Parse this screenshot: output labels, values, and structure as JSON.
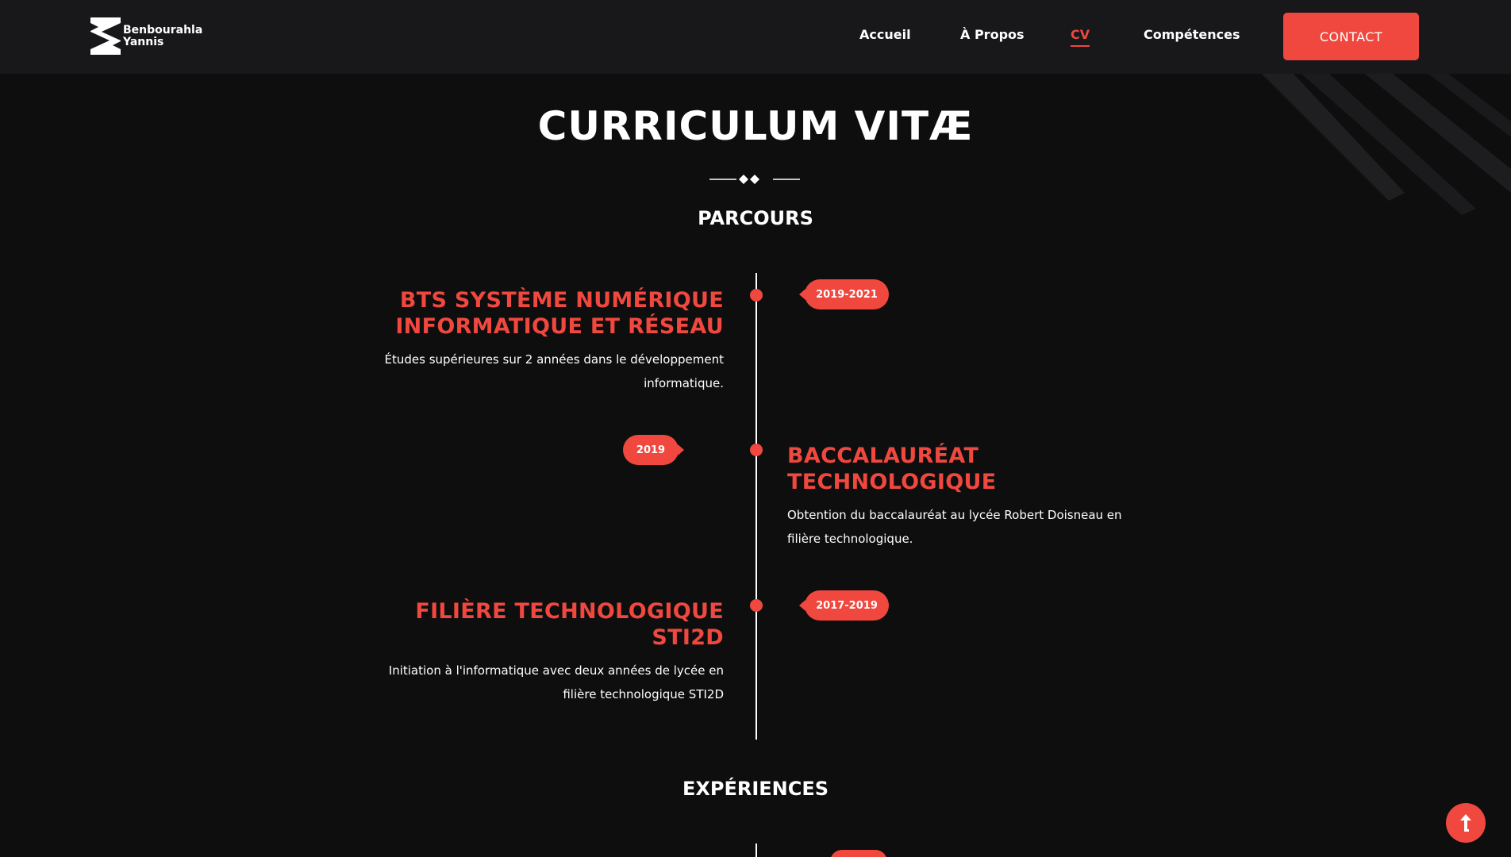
{
  "brand": {
    "line1": "Benbourahla",
    "line2": "Yannis",
    "logo_icon": "zigzag-logo-icon"
  },
  "nav": {
    "items": [
      {
        "label": "Accueil",
        "active": false
      },
      {
        "label": "À Propos",
        "active": false
      },
      {
        "label": "CV",
        "active": true
      },
      {
        "label": "Compétences",
        "active": false
      }
    ],
    "contact_label": "CONTACT"
  },
  "page": {
    "title": "CURRICULUM VITÆ",
    "section_parcours": "PARCOURS",
    "section_experiences": "EXPÉRIENCES"
  },
  "parcours": [
    {
      "period": "2019-2021",
      "title": "BTS SYSTÈME NUMÉRIQUE INFORMATIQUE ET RÉSEAU",
      "title_lines": [
        "BTS SYSTÈME NUMÉRIQUE",
        "INFORMATIQUE ET RÉSEAU"
      ],
      "desc_lines": [
        "Études supérieures sur 2 années dans le développement",
        "informatique."
      ]
    },
    {
      "period": "2019",
      "title": "BACCALAURÉAT TECHNOLOGIQUE",
      "title_lines": [
        "BACCALAURÉAT",
        "TECHNOLOGIQUE"
      ],
      "desc_lines": [
        "Obtention du baccalauréat au lycée Robert Doisneau en",
        "filière technologique."
      ]
    },
    {
      "period": "2017-2019",
      "title": "FILIÈRE TECHNOLOGIQUE STI2D",
      "title_lines": [
        "FILIÈRE TECHNOLOGIQUE",
        "STI2D"
      ],
      "desc_lines": [
        "Initiation à l'informatique avec deux années de lycée en",
        "filière technologique STI2D"
      ]
    }
  ],
  "colors": {
    "accent": "#f0483e",
    "background": "#0e0e0f",
    "header_background": "#18181b",
    "text": "#ffffff"
  },
  "icons": {
    "divider": "double-diamond-divider-icon",
    "scroll_top": "arrow-up-icon"
  }
}
